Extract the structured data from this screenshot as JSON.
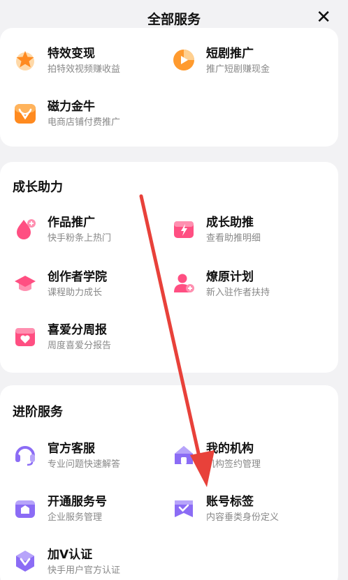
{
  "header": {
    "title": "全部服务",
    "close": "✕"
  },
  "section_top": {
    "items": [
      {
        "name": "特效变现",
        "desc": "拍特效视频赚收益",
        "icon": "star-icon"
      },
      {
        "name": "短剧推广",
        "desc": "推广短剧赚现金",
        "icon": "play-icon"
      },
      {
        "name": "磁力金牛",
        "desc": "电商店铺付费推广",
        "icon": "bull-icon"
      }
    ]
  },
  "section_growth": {
    "title": "成长助力",
    "items": [
      {
        "name": "作品推广",
        "desc": "快手粉条上热门",
        "icon": "flame-plus-icon"
      },
      {
        "name": "成长助推",
        "desc": "查看助推明细",
        "icon": "lightning-ticket-icon"
      },
      {
        "name": "创作者学院",
        "desc": "课程助力成长",
        "icon": "graduation-cap-icon"
      },
      {
        "name": "燎原计划",
        "desc": "新入驻作者扶持",
        "icon": "user-plus-icon"
      },
      {
        "name": "喜爱分周报",
        "desc": "周度喜爱分报告",
        "icon": "calendar-heart-icon"
      }
    ]
  },
  "section_advanced": {
    "title": "进阶服务",
    "items": [
      {
        "name": "官方客服",
        "desc": "专业问题快速解答",
        "icon": "headset-icon"
      },
      {
        "name": "我的机构",
        "desc": "机构签约管理",
        "icon": "house-icon"
      },
      {
        "name": "开通服务号",
        "desc": "企业服务管理",
        "icon": "shop-icon"
      },
      {
        "name": "账号标签",
        "desc": "内容垂类身份定义",
        "icon": "tag-check-icon"
      },
      {
        "name": "加V认证",
        "desc": "快手用户官方认证",
        "icon": "v-badge-icon"
      }
    ]
  },
  "colors": {
    "background": "#f2f2f4",
    "card": "#ffffff",
    "orange": "#ff8a1f",
    "pink": "#ff4f82",
    "purple": "#8b6cf5",
    "arrow": "#e8413a"
  }
}
